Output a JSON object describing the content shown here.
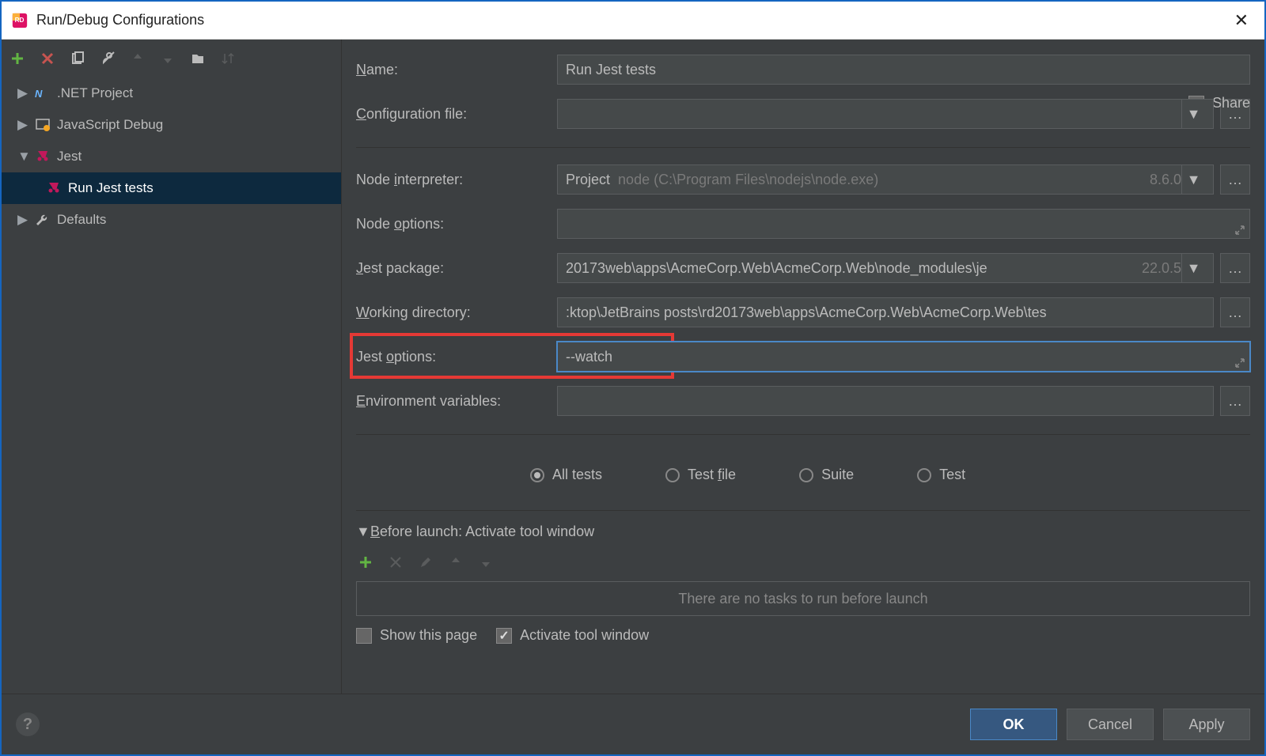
{
  "title": "Run/Debug Configurations",
  "tree": {
    "items": [
      {
        "label": ".NET Project",
        "expanded": false
      },
      {
        "label": "JavaScript Debug",
        "expanded": false
      },
      {
        "label": "Jest",
        "expanded": true
      },
      {
        "label": "Defaults",
        "expanded": false
      }
    ],
    "jest_child": "Run Jest tests"
  },
  "form": {
    "name_label": "Name:",
    "name_value": "Run Jest tests",
    "share_label": "Share",
    "config_file_label": "Configuration file:",
    "config_file_value": "",
    "node_interp_label": "Node interpreter:",
    "node_interp_prefix": "Project",
    "node_interp_value": "node (C:\\Program Files\\nodejs\\node.exe)",
    "node_interp_version": "8.6.0",
    "node_opts_label": "Node options:",
    "node_opts_value": "",
    "jest_pkg_label": "Jest package:",
    "jest_pkg_value": "20173web\\apps\\AcmeCorp.Web\\AcmeCorp.Web\\node_modules\\je",
    "jest_pkg_version": "22.0.5",
    "workdir_label": "Working directory:",
    "workdir_value": ":ktop\\JetBrains posts\\rd20173web\\apps\\AcmeCorp.Web\\AcmeCorp.Web\\tes",
    "jest_opts_label": "Jest options:",
    "jest_opts_value": "--watch",
    "env_label": "Environment variables:",
    "env_value": ""
  },
  "radios": {
    "all": "All tests",
    "file": "Test file",
    "suite": "Suite",
    "test": "Test"
  },
  "before": {
    "title": "Before launch: Activate tool window",
    "empty": "There are no tasks to run before launch",
    "show_page": "Show this page",
    "activate": "Activate tool window"
  },
  "buttons": {
    "ok": "OK",
    "cancel": "Cancel",
    "apply": "Apply"
  }
}
